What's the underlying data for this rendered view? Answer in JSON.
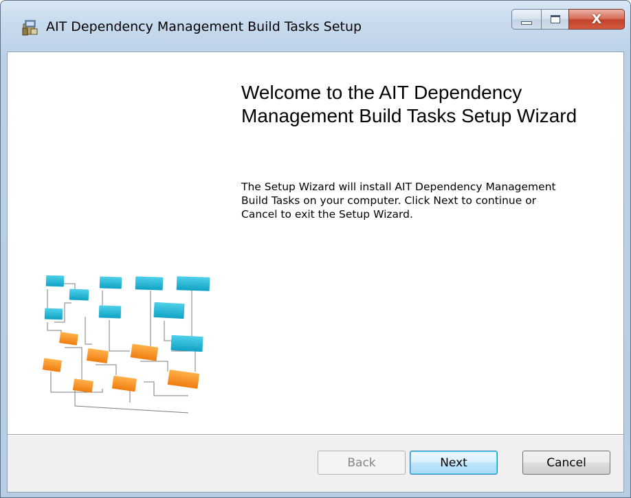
{
  "window": {
    "title": "AIT Dependency Management Build Tasks Setup",
    "app_icon": "installer-package-icon",
    "caption_buttons": {
      "minimize_icon": "minimize-icon",
      "maximize_icon": "maximize-icon",
      "close_icon": "close-icon",
      "close_glyph": "X"
    }
  },
  "content": {
    "heading_line1": "Welcome to the AIT Dependency",
    "heading_line2": "Management Build Tasks Setup Wizard",
    "description_line1": "The Setup Wizard will install AIT Dependency Management",
    "description_line2": "Build Tasks on your computer. Click Next to continue or",
    "description_line3": "Cancel to exit the Setup Wizard.",
    "illustration": "dependency-flowchart-illustration"
  },
  "buttons": {
    "back": {
      "label": "Back",
      "enabled": false
    },
    "next": {
      "label": "Next",
      "enabled": true,
      "default": true
    },
    "cancel": {
      "label": "Cancel",
      "enabled": true
    }
  },
  "colors": {
    "flow_node_blue": "#1fb6d6",
    "flow_node_orange": "#f7901e",
    "default_button_border": "#3c7fb1",
    "close_button_red": "#c3412b"
  }
}
